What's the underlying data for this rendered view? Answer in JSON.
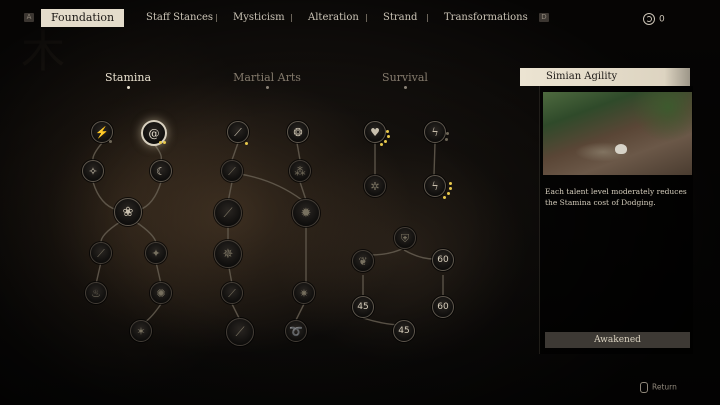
{
  "nav": {
    "left_key": "A",
    "right_key": "D",
    "tabs": [
      "Foundation",
      "Staff Stances",
      "Mysticism",
      "Alteration",
      "Strand",
      "Transformations"
    ],
    "active_tab": "Foundation",
    "currency_value": "0"
  },
  "sections": [
    {
      "label": "Stamina",
      "active": true
    },
    {
      "label": "Martial Arts",
      "active": false
    },
    {
      "label": "Survival",
      "active": false
    }
  ],
  "nodes": {
    "num_60a": "60",
    "num_45a": "45",
    "num_60b": "60",
    "num_45b": "45"
  },
  "panel": {
    "title": "Simian Agility",
    "description": "Each talent level moderately reduces the Stamina cost of Dodging.",
    "status": "Awakened"
  },
  "footer": {
    "return_label": "Return"
  },
  "colors": {
    "accent_pip": "#e7c84d",
    "active_tab_bg": "#e4dccb",
    "panel_title_bg": "#ece4d2"
  }
}
